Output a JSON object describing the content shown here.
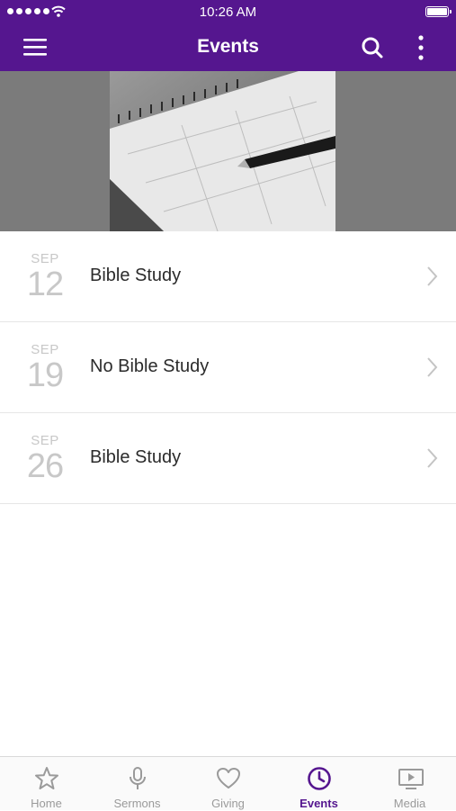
{
  "status_bar": {
    "time": "10:26 AM"
  },
  "header": {
    "title": "Events"
  },
  "events": [
    {
      "month": "SEP",
      "day": "12",
      "title": "Bible Study"
    },
    {
      "month": "SEP",
      "day": "19",
      "title": "No Bible Study"
    },
    {
      "month": "SEP",
      "day": "26",
      "title": "Bible Study"
    }
  ],
  "tabs": [
    {
      "label": "Home",
      "icon": "star-icon",
      "active": false
    },
    {
      "label": "Sermons",
      "icon": "microphone-icon",
      "active": false
    },
    {
      "label": "Giving",
      "icon": "heart-icon",
      "active": false
    },
    {
      "label": "Events",
      "icon": "clock-icon",
      "active": true
    },
    {
      "label": "Media",
      "icon": "play-screen-icon",
      "active": false
    }
  ],
  "colors": {
    "brand_purple": "#55168f",
    "inactive_tab": "#9a9a9a",
    "date_gray": "#c8c8c8"
  }
}
